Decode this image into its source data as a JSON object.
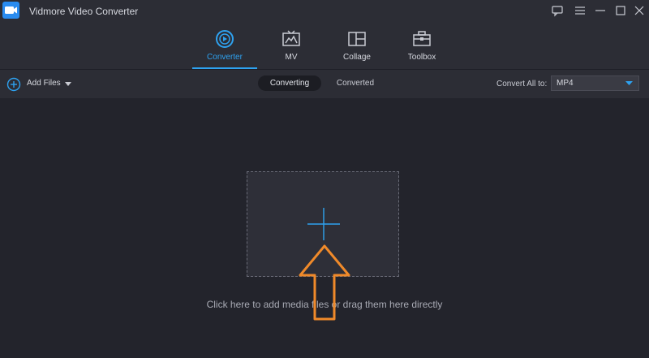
{
  "window": {
    "title": "Vidmore Video Converter",
    "controls": [
      "chat-icon",
      "menu-icon",
      "minimize-icon",
      "maximize-icon",
      "close-icon"
    ]
  },
  "nav": {
    "tabs": [
      {
        "label": "Converter",
        "icon": "converter-icon",
        "active": true
      },
      {
        "label": "MV",
        "icon": "mv-icon",
        "active": false
      },
      {
        "label": "Collage",
        "icon": "collage-icon",
        "active": false
      },
      {
        "label": "Toolbox",
        "icon": "toolbox-icon",
        "active": false
      }
    ]
  },
  "toolbar": {
    "add_files_label": "Add Files",
    "segments": [
      "Converting",
      "Converted"
    ],
    "active_segment": "Converting",
    "convert_all_label": "Convert All to:",
    "format_value": "MP4"
  },
  "main": {
    "hint": "Click here to add media files or drag them here directly"
  },
  "colors": {
    "accent": "#2ea2f0",
    "background": "#23242c",
    "arrow": "#f08a2a"
  }
}
